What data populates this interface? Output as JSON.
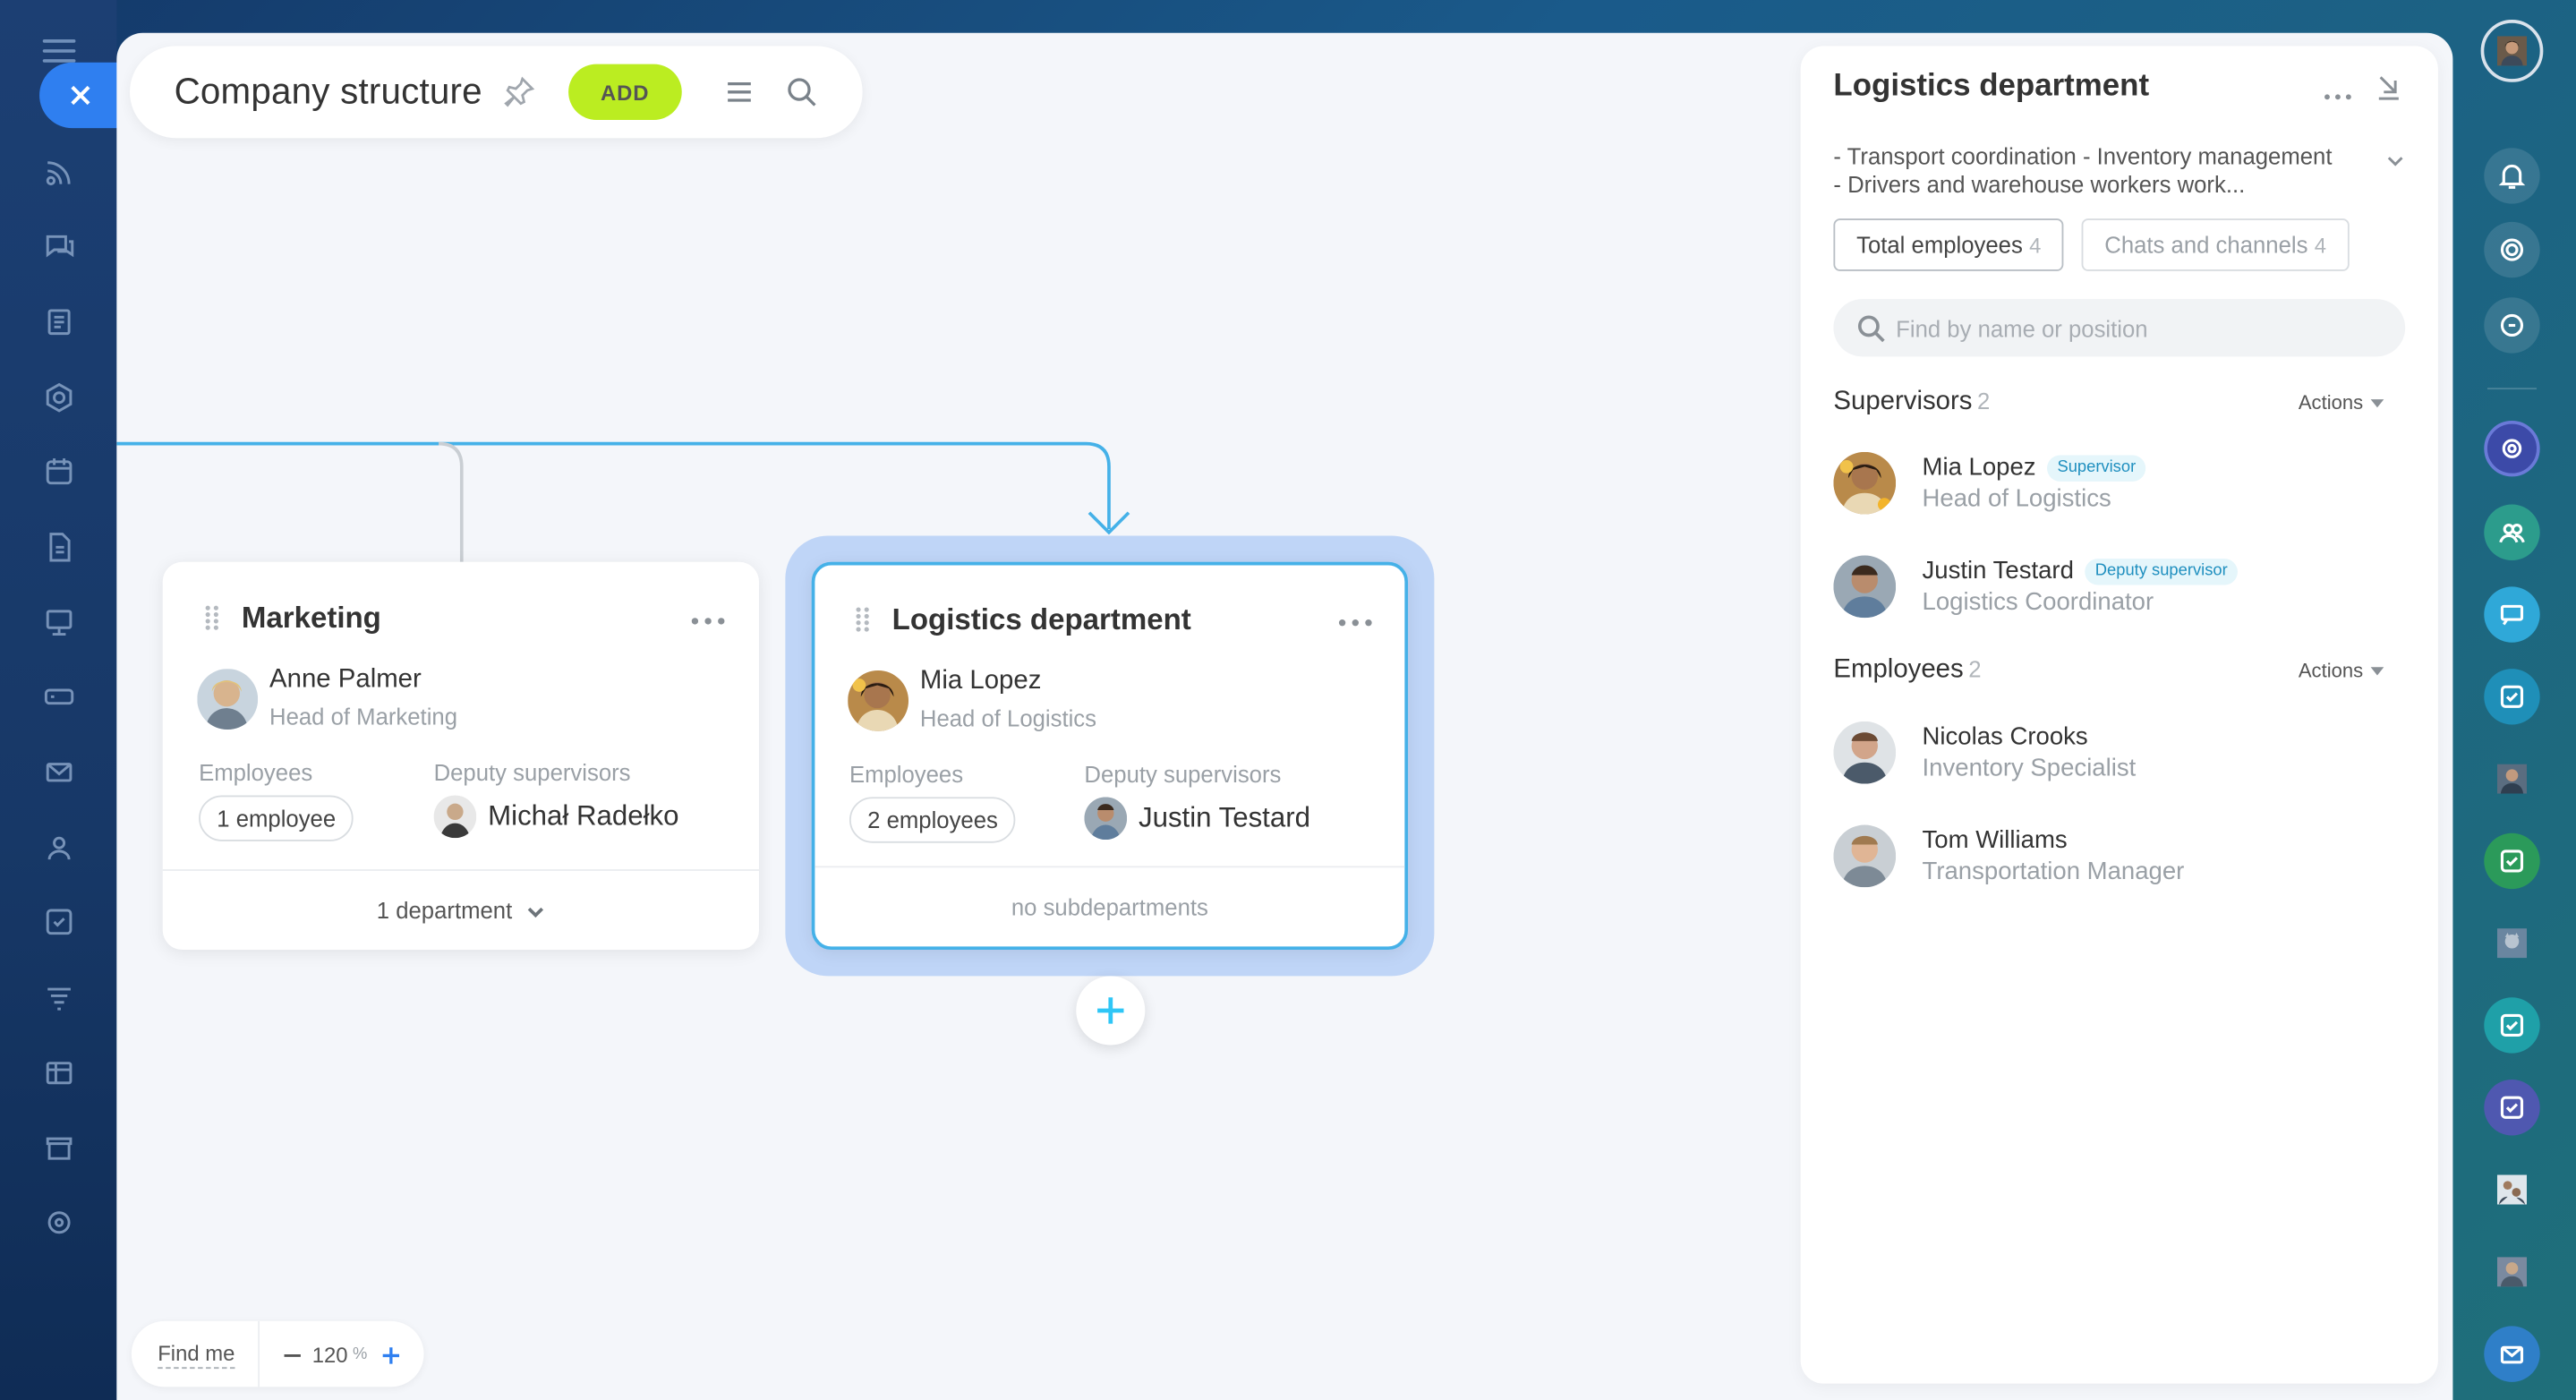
{
  "window": {
    "title": "Company structure",
    "add_label": "ADD"
  },
  "colors": {
    "accent": "#2f7ff0",
    "add_button": "#bbed21",
    "selection": "#45b1e8",
    "connector": "#45b1e8"
  },
  "departments": [
    {
      "name": "Marketing",
      "head_name": "Anne Palmer",
      "head_position": "Head of Marketing",
      "employees_label": "Employees",
      "employees_count": "1 employee",
      "deputies_label": "Deputy supervisors",
      "deputy_name": "Michał Radełko",
      "footer": "1 department"
    },
    {
      "name": "Logistics department",
      "head_name": "Mia Lopez",
      "head_position": "Head of Logistics",
      "employees_label": "Employees",
      "employees_count": "2 employees",
      "deputies_label": "Deputy supervisors",
      "deputy_name": "Justin Testard",
      "footer": "no subdepartments"
    }
  ],
  "zoom": {
    "find_me": "Find me",
    "value": "120",
    "unit": "%"
  },
  "panel": {
    "title": "Logistics department",
    "description_line1": "- Transport coordination - Inventory management",
    "description_line2": "- Drivers and warehouse workers work...",
    "tabs": [
      {
        "label": "Total employees",
        "count": "4"
      },
      {
        "label": "Chats and channels",
        "count": "4"
      }
    ],
    "search_placeholder": "Find by name or position",
    "supervisors": {
      "label": "Supervisors",
      "count": "2",
      "actions": "Actions",
      "items": [
        {
          "name": "Mia Lopez",
          "badge": "Supervisor",
          "position": "Head of Logistics"
        },
        {
          "name": "Justin Testard",
          "badge": "Deputy supervisor",
          "position": "Logistics Coordinator"
        }
      ]
    },
    "employees": {
      "label": "Employees",
      "count": "2",
      "actions": "Actions",
      "items": [
        {
          "name": "Nicolas Crooks",
          "position": "Inventory Specialist"
        },
        {
          "name": "Tom Williams",
          "position": "Transportation Manager"
        }
      ]
    }
  }
}
